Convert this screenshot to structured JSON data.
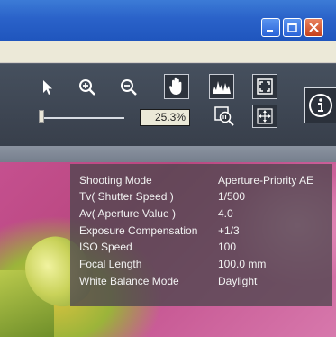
{
  "window": {
    "buttons": [
      "minimize",
      "maximize",
      "close"
    ]
  },
  "toolbar": {
    "tools": [
      {
        "name": "arrow-select",
        "icon": "arrow-pointer-icon"
      },
      {
        "name": "zoom-in",
        "icon": "zoom-in-icon"
      },
      {
        "name": "zoom-out",
        "icon": "zoom-out-icon"
      },
      {
        "name": "hand",
        "icon": "hand-icon"
      },
      {
        "name": "histogram",
        "icon": "histogram-icon"
      },
      {
        "name": "fit-window",
        "icon": "fit-window-icon"
      },
      {
        "name": "actual-size",
        "icon": "actual-size-icon"
      },
      {
        "name": "full-screen",
        "icon": "full-screen-icon"
      }
    ],
    "zoom_value": "25.3%",
    "info_button": "info-icon"
  },
  "info": {
    "rows": [
      {
        "key": "Shooting Mode",
        "value": "Aperture-Priority AE"
      },
      {
        "key": "Tv( Shutter Speed )",
        "value": "1/500"
      },
      {
        "key": "Av( Aperture Value )",
        "value": "4.0"
      },
      {
        "key": "Exposure Compensation",
        "value": "+1/3"
      },
      {
        "key": "ISO Speed",
        "value": "100"
      },
      {
        "key": "Focal Length",
        "value": "100.0 mm"
      },
      {
        "key": "White Balance Mode",
        "value": "Daylight"
      }
    ]
  },
  "colors": {
    "titlebar": "#2a62c9",
    "toolbar": "#3f4754",
    "panel": "#4e464e"
  }
}
